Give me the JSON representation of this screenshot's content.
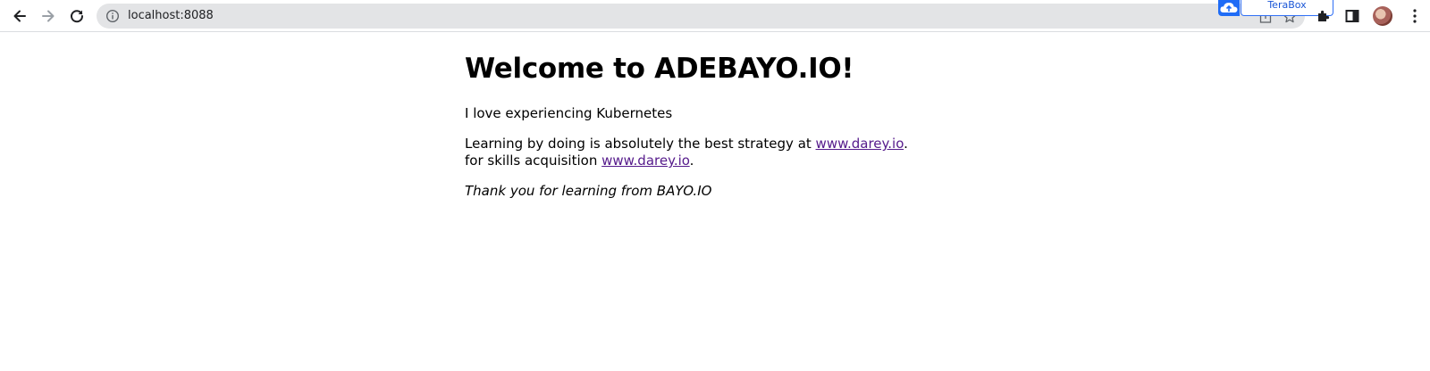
{
  "browser": {
    "back_icon": "arrow-left-icon",
    "forward_icon": "arrow-right-icon",
    "reload_icon": "reload-icon",
    "site_info_icon": "info-icon",
    "url": "localhost:8088",
    "share_icon": "share-icon",
    "bookmark_icon": "star-icon",
    "extension_label": "TeraBox",
    "extensions_icon": "puzzle-icon",
    "side_panel_icon": "side-panel-icon",
    "profile_icon": "avatar",
    "menu_icon": "more-vert-icon"
  },
  "page": {
    "heading": "Welcome to ADEBAYO.IO!",
    "line1": "I love experiencing Kubernetes",
    "line2_prefix": "Learning by doing is absolutely the best strategy at ",
    "line2_link": "www.darey.io",
    "line2_suffix": ".",
    "line3_prefix": "for skills acquisition ",
    "line3_link": "www.darey.io",
    "line3_suffix": ".",
    "footer": "Thank you for learning from BAYO.IO",
    "link_color": "#551a8b"
  }
}
